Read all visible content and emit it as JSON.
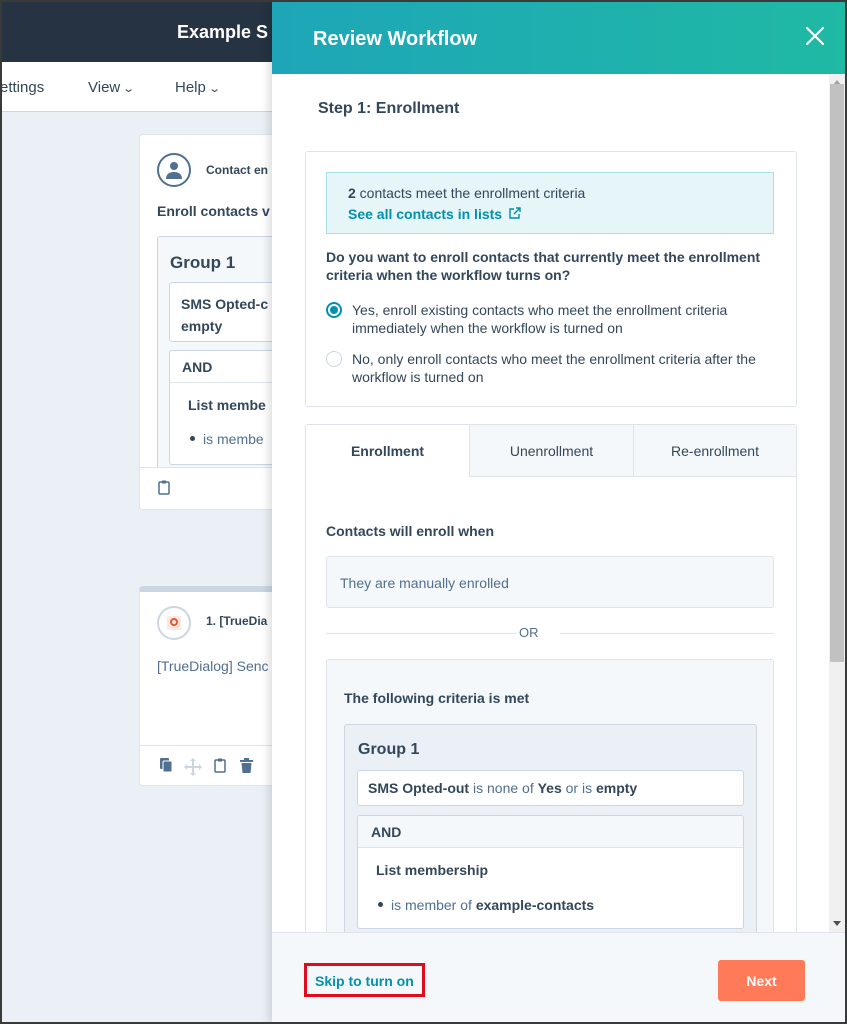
{
  "app": {
    "title": "Example S",
    "menu": [
      {
        "label": "ettings",
        "chevron": false
      },
      {
        "label": "View",
        "chevron": true
      },
      {
        "label": "Help",
        "chevron": true
      }
    ]
  },
  "canvas": {
    "card1": {
      "icon": "contact-icon",
      "title": "Contact en",
      "subtitle": "Enroll contacts v",
      "group_title": "Group 1",
      "filter_line1": "SMS Opted-c",
      "filter_line2": "empty",
      "and_label": "AND",
      "list_title": "List membe",
      "list_item": "is membe",
      "footer_icons": [
        "clipboard-icon"
      ]
    },
    "card2": {
      "icon": "truedialog-logo-icon",
      "title": "1. [TrueDia",
      "body": "[TrueDialog] Senc",
      "footer_icons": [
        "copy-icon",
        "move-icon",
        "clipboard-icon",
        "trash-icon"
      ]
    }
  },
  "panel": {
    "title": "Review Workflow",
    "close_icon": "close-icon",
    "step_title": "Step 1: Enrollment",
    "info": {
      "count": "2",
      "count_text": " contacts meet the enrollment criteria",
      "link_label": "See all contacts in lists",
      "link_icon": "external-link-icon"
    },
    "question": "Do you want to enroll contacts that currently meet the enrollment criteria when the workflow turns on?",
    "options": [
      {
        "label": "Yes, enroll existing contacts who meet the enrollment criteria immediately when the workflow is turned on",
        "checked": true
      },
      {
        "label": "No, only enroll contacts who meet the enrollment criteria after the workflow is turned on",
        "checked": false
      }
    ],
    "tabs": [
      {
        "label": "Enrollment",
        "active": true
      },
      {
        "label": "Unenrollment",
        "active": false
      },
      {
        "label": "Re-enrollment",
        "active": false
      }
    ],
    "enroll_when_label": "Contacts will enroll when",
    "manual_enroll": "They are manually enrolled",
    "or_label": "OR",
    "criteria_title": "The following criteria is met",
    "group": {
      "title": "Group 1",
      "filter": {
        "property": "SMS Opted-out",
        "op1": " is none of ",
        "value1": "Yes",
        "op2": " or is ",
        "value2": "empty"
      },
      "and_label": "AND",
      "list_title": "List membership",
      "list_item_prefix": "is member of ",
      "list_item_value": "example-contacts"
    },
    "footer": {
      "skip_label": "Skip to turn on",
      "next_label": "Next"
    },
    "scroll_position_fraction": 0.0
  },
  "colors": {
    "header_gradient_start": "#1ea6b8",
    "header_gradient_end": "#1fb9a4",
    "link": "#0091ae",
    "primary_button": "#ff7a59",
    "highlight_border": "#e00b1c",
    "topbar": "#253342"
  }
}
